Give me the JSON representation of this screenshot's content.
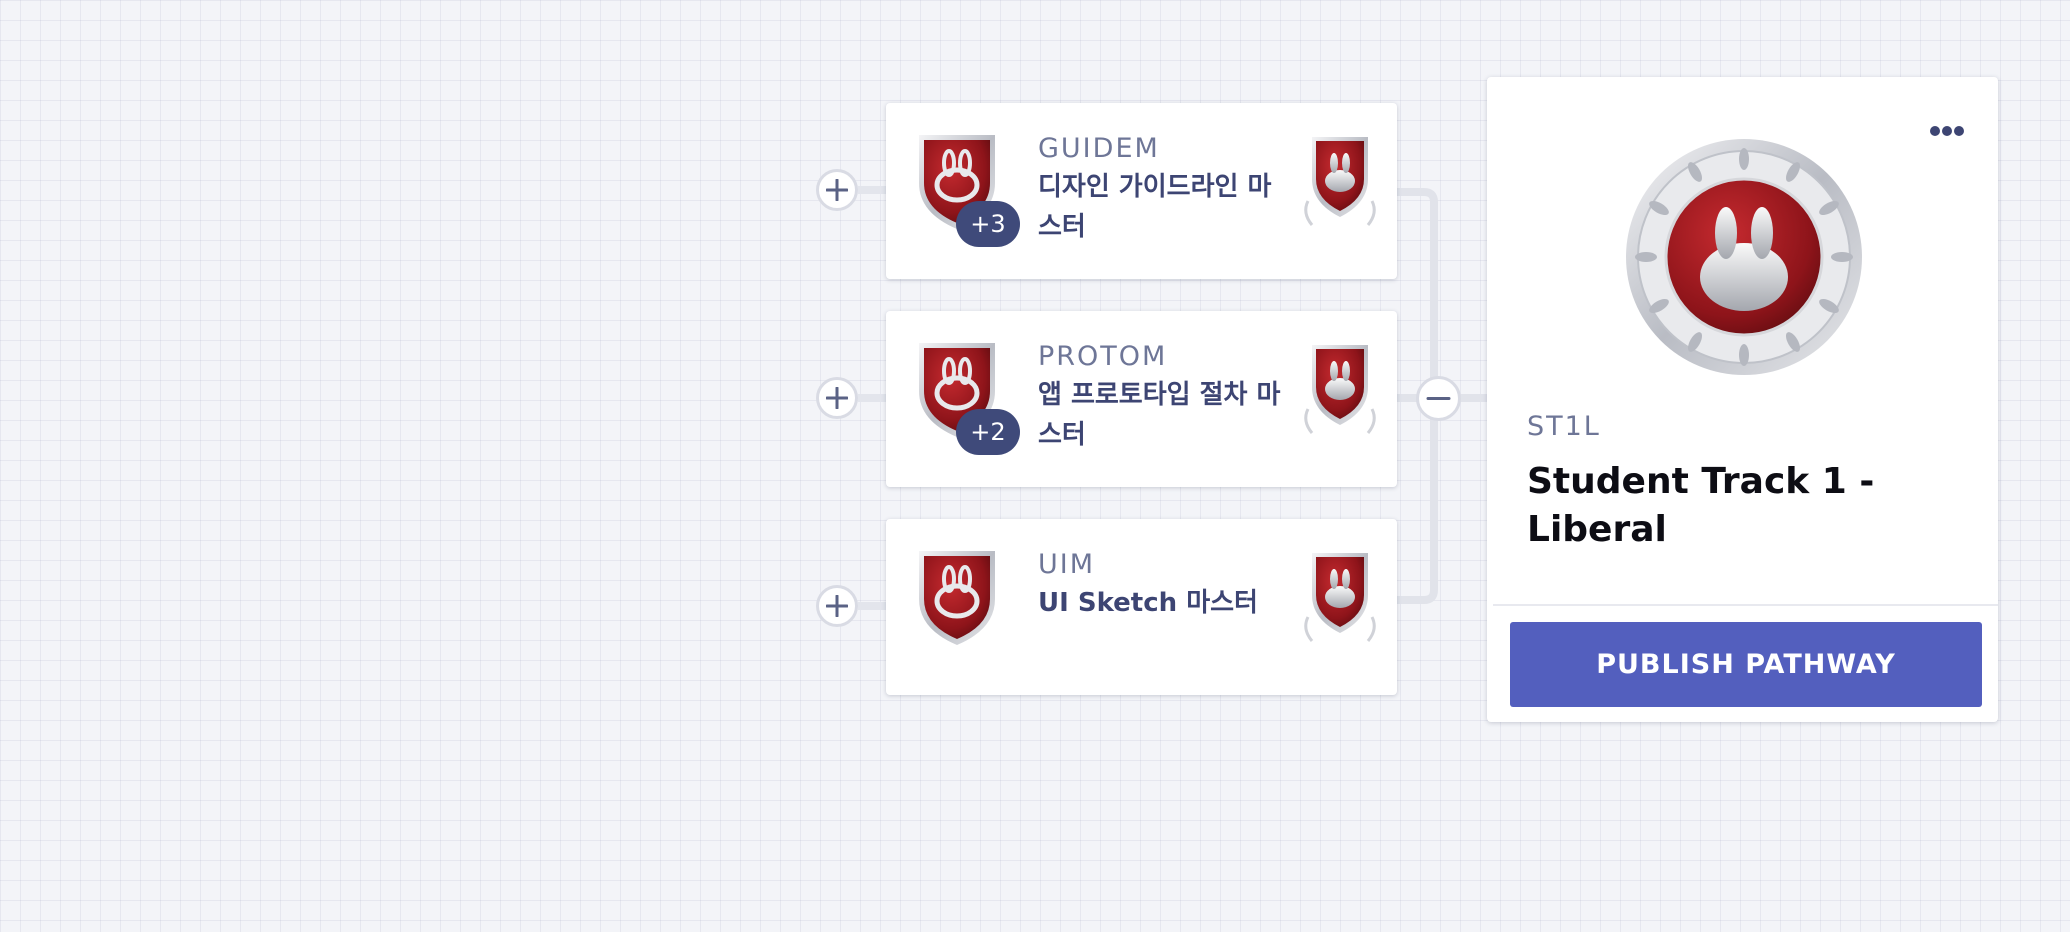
{
  "badges": [
    {
      "code": "GUIDEM",
      "title": "디자인 가이드라인 마스터",
      "extra_count": "+3"
    },
    {
      "code": "PROTOM",
      "title": "앱 프로토타입 절차 마스터",
      "extra_count": "+2"
    },
    {
      "code": "UIM",
      "title": "UI Sketch 마스터",
      "extra_count": ""
    }
  ],
  "pathway": {
    "code": "ST1L",
    "title": "Student Track 1 - Liberal",
    "publish_label": "PUBLISH PATHWAY"
  },
  "icons": {
    "add": "plus-icon",
    "collapse": "minus-icon",
    "menu": "more-horizontal-icon",
    "badge": "shield-bunny-icon",
    "pathway_badge": "medal-bunny-icon"
  },
  "colors": {
    "accent": "#535fbe",
    "badge_red": "#9e1a1f",
    "label_navy": "#3d4573",
    "code_gray": "#6e7697",
    "count_pill": "#3f4a7a"
  }
}
